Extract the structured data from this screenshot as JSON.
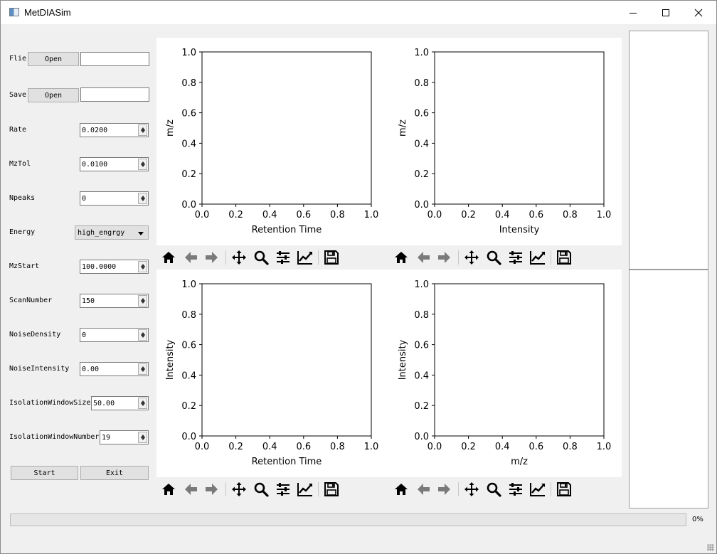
{
  "window": {
    "title": "MetDIASim",
    "icon": "app-window-icon"
  },
  "form": {
    "file_label": "Flie",
    "file_button": "Open",
    "file_value": "",
    "save_label": "Save",
    "save_button": "Open",
    "save_value": "",
    "fields": [
      {
        "label": "Rate",
        "value": "0.0200"
      },
      {
        "label": "MzTol",
        "value": "0.0100"
      },
      {
        "label": "Npeaks",
        "value": "0"
      },
      {
        "label": "Energy",
        "value": "high_engrgy",
        "type": "combo"
      },
      {
        "label": "MzStart",
        "value": "100.0000"
      },
      {
        "label": "ScanNumber",
        "value": "150"
      },
      {
        "label": "NoiseDensity",
        "value": "0"
      },
      {
        "label": "NoiseIntensity",
        "value": "0.00"
      },
      {
        "label": "IsolationWindowSize",
        "value": "50.00"
      },
      {
        "label": "IsolationWindowNumber",
        "value": "19"
      }
    ],
    "start_button": "Start",
    "exit_button": "Exit"
  },
  "plots": [
    {
      "xlabel": "Retention Time",
      "ylabel": "m/z"
    },
    {
      "xlabel": "Intensity",
      "ylabel": "m/z"
    },
    {
      "xlabel": "Retention Time",
      "ylabel": "Intensity"
    },
    {
      "xlabel": "m/z",
      "ylabel": "Intensity"
    }
  ],
  "ticks": [
    "0.0",
    "0.2",
    "0.4",
    "0.6",
    "0.8",
    "1.0"
  ],
  "toolbar_icons": [
    "home-icon",
    "back-arrow-icon",
    "forward-arrow-icon",
    "pan-icon",
    "zoom-icon",
    "subplots-config-icon",
    "edit-curve-icon",
    "save-icon"
  ],
  "progress": {
    "value": 0,
    "text": "0%"
  },
  "colors": {
    "plot_bg": "#ffffff",
    "window_bg": "#f0f0f0"
  }
}
